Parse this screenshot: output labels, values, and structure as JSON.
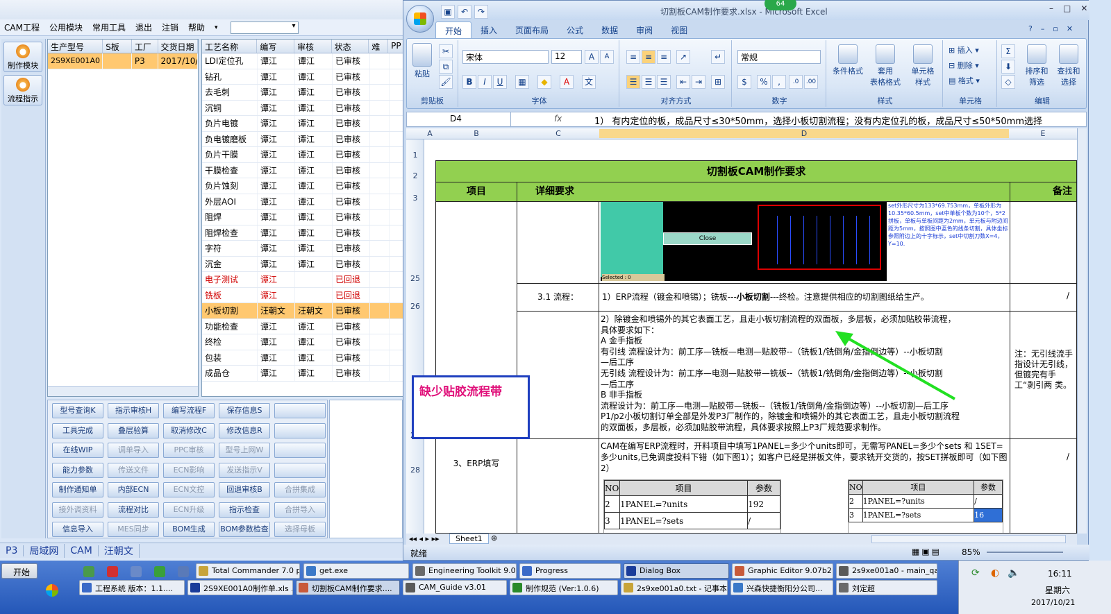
{
  "cam": {
    "menu": [
      "CAM工程",
      "公用模块",
      "常用工具",
      "退出",
      "注销",
      "帮助"
    ],
    "side_buttons": [
      "制作模块",
      "流程指示"
    ],
    "model_grid": {
      "headers": [
        "生产型号",
        "S板",
        "工厂",
        "交货日期"
      ],
      "rows": [
        [
          "2S9XE001A0",
          "",
          "P3",
          "2017/10/"
        ]
      ]
    },
    "process_grid": {
      "headers": [
        "工艺名称",
        "编写",
        "审核",
        "状态",
        "难",
        "PP"
      ],
      "rows": [
        {
          "name": "LDI定位孔",
          "writer": "谭江",
          "reviewer": "谭江",
          "status": "已审核",
          "style": ""
        },
        {
          "name": "钻孔",
          "writer": "谭江",
          "reviewer": "谭江",
          "status": "已审核",
          "style": ""
        },
        {
          "name": "去毛刺",
          "writer": "谭江",
          "reviewer": "谭江",
          "status": "已审核",
          "style": ""
        },
        {
          "name": "沉铜",
          "writer": "谭江",
          "reviewer": "谭江",
          "status": "已审核",
          "style": ""
        },
        {
          "name": "负片电镀",
          "writer": "谭江",
          "reviewer": "谭江",
          "status": "已审核",
          "style": ""
        },
        {
          "name": "负电镀磨板",
          "writer": "谭江",
          "reviewer": "谭江",
          "status": "已审核",
          "style": ""
        },
        {
          "name": "负片干膜",
          "writer": "谭江",
          "reviewer": "谭江",
          "status": "已审核",
          "style": ""
        },
        {
          "name": "干膜检查",
          "writer": "谭江",
          "reviewer": "谭江",
          "status": "已审核",
          "style": ""
        },
        {
          "name": "负片蚀刻",
          "writer": "谭江",
          "reviewer": "谭江",
          "status": "已审核",
          "style": ""
        },
        {
          "name": "外层AOI",
          "writer": "谭江",
          "reviewer": "谭江",
          "status": "已审核",
          "style": ""
        },
        {
          "name": "阻焊",
          "writer": "谭江",
          "reviewer": "谭江",
          "status": "已审核",
          "style": ""
        },
        {
          "name": "阻焊检查",
          "writer": "谭江",
          "reviewer": "谭江",
          "status": "已审核",
          "style": ""
        },
        {
          "name": "字符",
          "writer": "谭江",
          "reviewer": "谭江",
          "status": "已审核",
          "style": ""
        },
        {
          "name": "沉金",
          "writer": "谭江",
          "reviewer": "谭江",
          "status": "已审核",
          "style": ""
        },
        {
          "name": "电子测试",
          "writer": "谭江",
          "reviewer": "",
          "status": "已回退",
          "style": "red"
        },
        {
          "name": "铣板",
          "writer": "谭江",
          "reviewer": "",
          "status": "已回退",
          "style": "red"
        },
        {
          "name": "小板切割",
          "writer": "汪朝文",
          "reviewer": "汪朝文",
          "status": "已审核",
          "style": "sel"
        },
        {
          "name": "功能检查",
          "writer": "谭江",
          "reviewer": "谭江",
          "status": "已审核",
          "style": ""
        },
        {
          "name": "终检",
          "writer": "谭江",
          "reviewer": "谭江",
          "status": "已审核",
          "style": ""
        },
        {
          "name": "包装",
          "writer": "谭江",
          "reviewer": "谭江",
          "status": "已审核",
          "style": ""
        },
        {
          "name": "成品仓",
          "writer": "谭江",
          "reviewer": "谭江",
          "status": "已审核",
          "style": ""
        }
      ]
    },
    "buttons": [
      [
        "型号查询K",
        "指示审核H",
        "编写流程F",
        "保存信息S",
        ""
      ],
      [
        "工具完成",
        "叠层验算",
        "取消修改C",
        "修改信息R",
        ""
      ],
      [
        "在线WIP",
        "调单导入",
        "PPC审核",
        "型号上网W",
        ""
      ],
      [
        "能力参数",
        "传送文件",
        "ECN影响",
        "发送指示V",
        ""
      ],
      [
        "制作通知单",
        "内部ECN",
        "ECN文控",
        "回退审核B",
        "合拼集成"
      ],
      [
        "接外调资料",
        "流程对比",
        "ECN升级",
        "指示检查",
        "合拼导入"
      ],
      [
        "信息导入",
        "MES同步",
        "BOM生成",
        "BOM参数检查",
        "选择母板"
      ]
    ],
    "disabled_buttons": [
      "调单导入",
      "PPC审核",
      "型号上网W",
      "传送文件",
      "ECN影响",
      "发送指示V",
      "ECN文控",
      "合拼集成",
      "接外调资料",
      "ECN升级",
      "合拼导入",
      "MES同步",
      "选择母板"
    ],
    "status": [
      "P3",
      "局域网",
      "CAM",
      "汪朝文"
    ]
  },
  "excel": {
    "title": "切割板CAM制作要求.xlsx - Microsoft Excel",
    "badge": "64",
    "tabs": [
      "开始",
      "插入",
      "页面布局",
      "公式",
      "数据",
      "审阅",
      "视图"
    ],
    "ribbon": {
      "paste": "粘贴",
      "clipboard": "剪贴板",
      "font_name": "宋体",
      "font_size": "12",
      "font_group": "字体",
      "align_group": "对齐方式",
      "number_format": "常规",
      "number_group": "数字",
      "styles": [
        "条件格式",
        "套用\n表格格式",
        "单元格\n样式"
      ],
      "styles_group": "样式",
      "cells": [
        "插入",
        "删除",
        "格式"
      ],
      "cells_group": "单元格",
      "edit": [
        "排序和\n筛选",
        "查找和\n选择"
      ],
      "edit_group": "编辑"
    },
    "name_box": "D4",
    "fx": "fx",
    "formula": "1）  有内定位的板，成品尺寸≤30*50mm，选择小板切割流程；没有内定位孔的板，成品尺寸≤50*50mm选择",
    "columns": [
      "A",
      "B",
      "C",
      "D",
      "E"
    ],
    "rows": [
      "1",
      "2",
      "3",
      "25",
      "26",
      "27",
      "28"
    ],
    "sheet": {
      "title": "切割板CAM制作要求",
      "header_item": "项目",
      "header_detail": "详细要求",
      "header_note": "备注",
      "img_text": "set外形尺寸为133*69.753mm，单板外形为10.35*60.5mm，set中单板个数为10个，5*2拼板，单板与单板间距为2mm，单元板与附边间距为5mm，按照图中蓝色的线条切割，具体坐标参照附边上的十字标示，set中切割刀数X=4，Y=10.",
      "img_close": "Close",
      "img_selected": "Selected : 0",
      "r26_c": "3.1  流程：",
      "r26_d_pre": "1）ERP流程（镀金和喷锡）；铣板---",
      "r26_d_bold": "小板切割",
      "r26_d_post": "---终检。注意提供相应的切割图纸给生产。",
      "r26_e": "/",
      "r27_lines": [
        "2）除镀金和喷锡外的其它表面工艺，且走小板切割流程的双面板，多层板，必须加贴胶带流程，",
        "具体要求如下：",
        "A  金手指板",
        "有引线  流程设计为：前工序—铣板—电测—贴胶带--（铣板1/铣倒角/金指倒边等）--小板切割",
        "—后工序",
        "无引线  流程设计为：前工序—电测—贴胶带—铣板--（铣板1/铣倒角/金指倒边等）--小板切割",
        "—后工序",
        "B   非手指板",
        "流程设计为：前工序—电测—贴胶带—铣板--（铣板1/铣倒角/金指倒边等）--小板切割—后工序",
        "P1/p2小板切割订单全部是外发P3厂制作的，除镀金和喷锡外的其它表面工艺，且走小板切割流程",
        "的双面板，多层板，必须加贴胶带流程，具体要求按照上P3厂规范要求制作。"
      ],
      "r27_note": "注：无引线流手指设计无引线，但镀完有手工“剥引两  类。",
      "annotation": "缺少贴胶流程带",
      "r28_b": "3、ERP填写",
      "r28_d": "CAM在编写ERP流程时，开料项目中填写1PANEL=多少个units即可，无需写PANEL=多少个sets 和 1SET= 多少units,已免调度投料下错（如下图1）；如客户已经是拼板文件，要求铣开交货的，按SET拼板即可（如下图2）",
      "r28_e": "/",
      "table1": {
        "headers": [
          "NO",
          "项目",
          "参数"
        ],
        "rows": [
          [
            "2",
            "1PANEL=?units",
            "192"
          ],
          [
            "3",
            "1PANEL=?sets",
            "/"
          ]
        ]
      },
      "table2": {
        "headers": [
          "NO",
          "项目",
          "参数"
        ],
        "rows": [
          [
            "2",
            "1PANEL=?units",
            "/"
          ],
          [
            "3",
            "1PANEL=?sets",
            "16"
          ]
        ]
      }
    },
    "sheet_tab": "Sheet1",
    "status_left": "就绪",
    "zoom": "85%"
  },
  "taskbar": {
    "start": "开始",
    "row1": [
      "Total Commander 7.0 p...",
      "get.exe",
      "Engineering Toolkit 9.07...",
      "Progress",
      "Dialog Box",
      "Graphic Editor 9.07b2 (...",
      "2s9xe001a0 - main_qa"
    ],
    "row2": [
      "工程系统  版本：1.1....",
      "2S9XE001A0制作单.xls ...",
      "切割板CAM制作要求....",
      "CAM_Guide v3.01",
      "制作规范 (Ver:1.0.6)",
      "2s9xe001a0.txt - 记事本",
      "兴森快捷衡阳分公司...",
      "刘定超"
    ],
    "time": "16:11",
    "weekday": "星期六",
    "date": "2017/10/21"
  },
  "colors": {
    "green_header": "#92d050",
    "annotation_text": "#e0107a",
    "annotation_border": "#1f3fbf",
    "arrow": "#22e022",
    "selected_row": "#ffc870"
  }
}
